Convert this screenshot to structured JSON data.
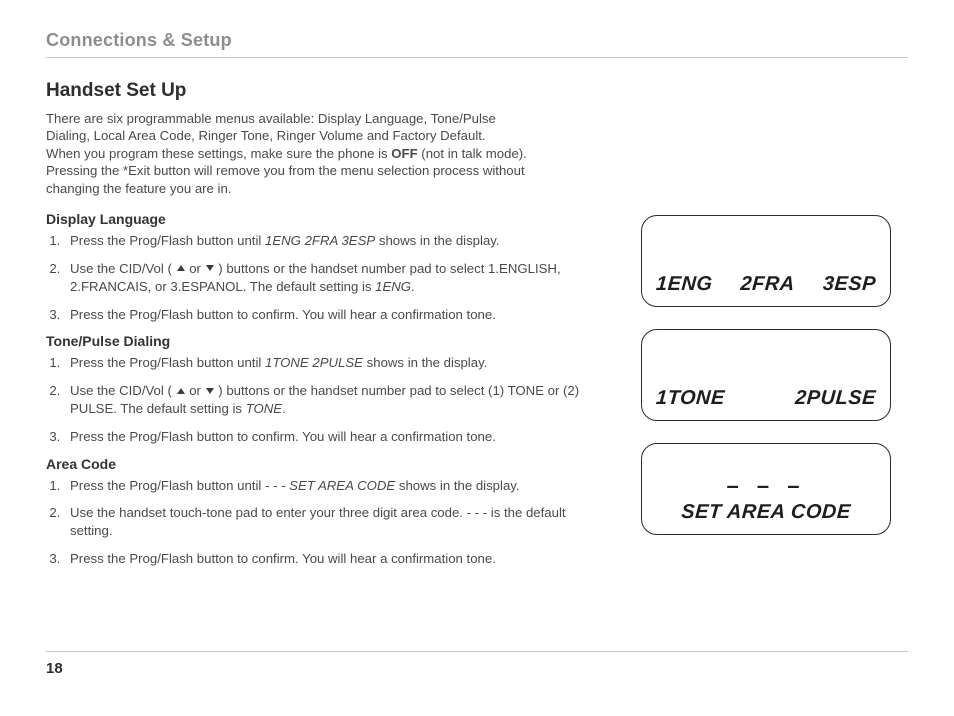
{
  "breadcrumb": "Connections & Setup",
  "title": "Handset Set Up",
  "intro_lines": [
    "There are six programmable menus available: Display Language, Tone/Pulse",
    "Dialing, Local Area Code, Ringer Tone, Ringer Volume and Factory Default.",
    "When you program these settings, make sure the phone is ",
    " (not in talk mode).",
    "Pressing the *Exit button will remove you from the menu selection process without",
    "changing the feature you are in."
  ],
  "intro_bold": "OFF",
  "sections": {
    "display_language": {
      "heading": "Display Language",
      "step1_a": "Press the Prog/Flash button until ",
      "step1_ital": "1ENG 2FRA 3ESP",
      "step1_b": " shows in the display.",
      "step2_a": "Use the CID/Vol ( ",
      "step2_mid": " or ",
      "step2_b": " ) buttons or the handset number pad to select 1.ENGLISH, 2.FRANCAIS, or 3.ESPANOL. The default setting is ",
      "step2_ital": "1ENG",
      "step2_c": ".",
      "step3": "Press the Prog/Flash button to confirm. You will hear a confirmation tone."
    },
    "tone_pulse": {
      "heading": "Tone/Pulse Dialing",
      "step1_a": "Press the Prog/Flash button until ",
      "step1_ital": "1TONE 2PULSE",
      "step1_b": " shows in the display.",
      "step2_a": "Use the CID/Vol ( ",
      "step2_mid": " or ",
      "step2_b": " ) buttons or the handset number pad to select (1) TONE or (2) PULSE. The default setting is ",
      "step2_ital": "TONE",
      "step2_c": ".",
      "step3": "Press the Prog/Flash button to confirm. You will hear a confirmation tone."
    },
    "area_code": {
      "heading": "Area Code",
      "step1_a": "Press the Prog/Flash button until ",
      "step1_ital": "- - - SET AREA CODE",
      "step1_b": " shows in the display.",
      "step2": "Use the handset touch-tone pad to enter your three digit area code. - - - is the default setting.",
      "step3": "Press the Prog/Flash button to confirm. You will hear a confirmation tone."
    }
  },
  "lcd": {
    "lang": {
      "a": "1ENG",
      "b": "2FRA",
      "c": "3ESP"
    },
    "tone": {
      "a": "1TONE",
      "b": "2PULSE"
    },
    "area": {
      "dashes": "– – –",
      "label": "SET AREA CODE"
    }
  },
  "page_number": "18"
}
